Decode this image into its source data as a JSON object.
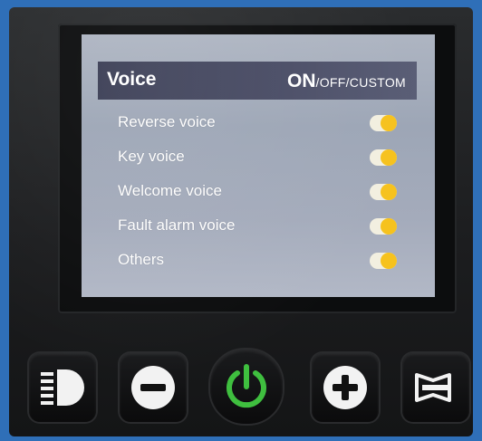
{
  "screen": {
    "title": "Voice",
    "mode_on": "ON",
    "mode_rest": "/OFF/CUSTOM",
    "items": [
      {
        "label": "Reverse voice",
        "state": "on"
      },
      {
        "label": "Key voice",
        "state": "on"
      },
      {
        "label": "Welcome voice",
        "state": "on"
      },
      {
        "label": "Fault alarm voice",
        "state": "on"
      },
      {
        "label": "Others",
        "state": "on"
      }
    ]
  },
  "buttons": [
    {
      "name": "headlight-button",
      "icon": "headlight-icon"
    },
    {
      "name": "minus-button",
      "icon": "minus-icon"
    },
    {
      "name": "power-button",
      "icon": "power-icon"
    },
    {
      "name": "plus-button",
      "icon": "plus-icon"
    },
    {
      "name": "horn-button",
      "icon": "horn-icon"
    }
  ],
  "colors": {
    "toggle_knob": "#f6c21e",
    "toggle_track": "#f2efe0",
    "power_icon": "#3fbf3f",
    "header_bg": "#3b3e55"
  }
}
